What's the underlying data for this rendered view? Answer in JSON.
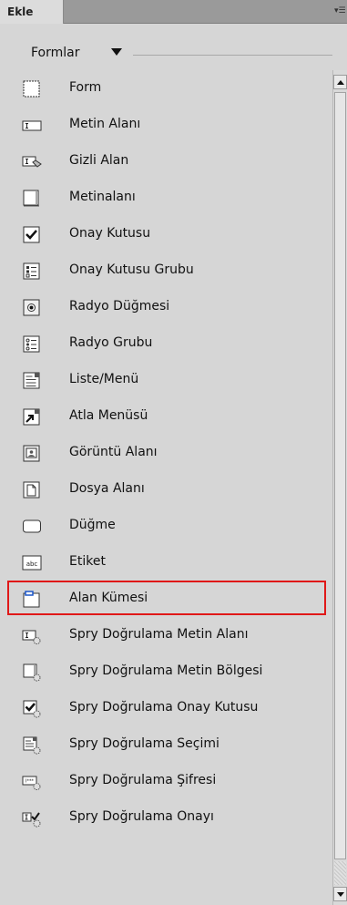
{
  "panel": {
    "tab_label": "Ekle",
    "category": "Formlar"
  },
  "items": [
    {
      "label": "Form",
      "icon": "form-icon"
    },
    {
      "label": "Metin Alanı",
      "icon": "text-field-icon"
    },
    {
      "label": "Gizli Alan",
      "icon": "hidden-field-icon"
    },
    {
      "label": "Metinalanı",
      "icon": "textarea-icon"
    },
    {
      "label": "Onay Kutusu",
      "icon": "checkbox-icon"
    },
    {
      "label": "Onay Kutusu Grubu",
      "icon": "checkbox-group-icon"
    },
    {
      "label": "Radyo Düğmesi",
      "icon": "radio-button-icon"
    },
    {
      "label": "Radyo Grubu",
      "icon": "radio-group-icon"
    },
    {
      "label": "Liste/Menü",
      "icon": "list-menu-icon"
    },
    {
      "label": "Atla Menüsü",
      "icon": "jump-menu-icon"
    },
    {
      "label": "Görüntü Alanı",
      "icon": "image-field-icon"
    },
    {
      "label": "Dosya Alanı",
      "icon": "file-field-icon"
    },
    {
      "label": "Düğme",
      "icon": "button-icon"
    },
    {
      "label": "Etiket",
      "icon": "label-icon"
    },
    {
      "label": "Alan Kümesi",
      "icon": "fieldset-icon",
      "highlighted": true
    },
    {
      "label": "Spry Doğrulama Metin Alanı",
      "icon": "spry-text-field-icon"
    },
    {
      "label": "Spry Doğrulama Metin Bölgesi",
      "icon": "spry-textarea-icon"
    },
    {
      "label": "Spry Doğrulama Onay Kutusu",
      "icon": "spry-checkbox-icon"
    },
    {
      "label": "Spry Doğrulama Seçimi",
      "icon": "spry-select-icon"
    },
    {
      "label": "Spry Doğrulama Şifresi",
      "icon": "spry-password-icon"
    },
    {
      "label": "Spry Doğrulama Onayı",
      "icon": "spry-confirm-icon"
    }
  ],
  "colors": {
    "highlight_border": "#e01818",
    "panel_bg": "#d6d6d6"
  }
}
